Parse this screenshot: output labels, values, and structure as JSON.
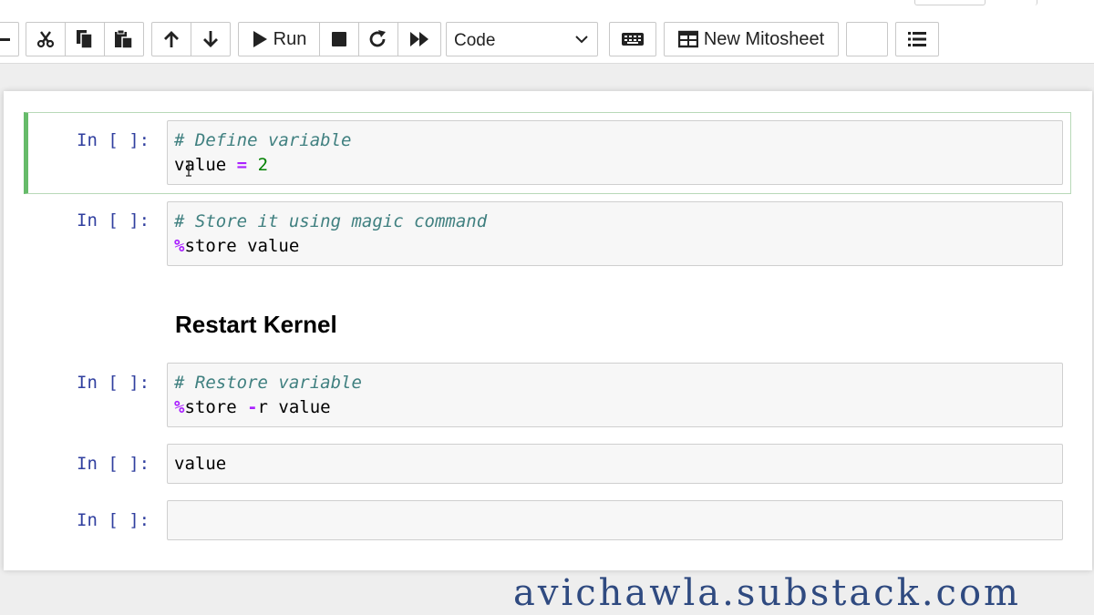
{
  "toolbar": {
    "run_label": "Run",
    "cell_type": "Code",
    "mitosheet_label": "New Mitosheet"
  },
  "cells": [
    {
      "prompt": "In [ ]:",
      "comment": "# Define variable",
      "code": [
        "value",
        "=",
        "2"
      ]
    },
    {
      "prompt": "In [ ]:",
      "comment": "# Store it using magic command",
      "code": [
        "%",
        "store value"
      ]
    },
    {
      "heading": "Restart Kernel"
    },
    {
      "prompt": "In [ ]:",
      "comment": "# Restore variable",
      "code": [
        "%",
        "store ",
        "-",
        "r value"
      ]
    },
    {
      "prompt": "In [ ]:",
      "code": [
        "value"
      ]
    },
    {
      "prompt": "In [ ]:",
      "code": []
    }
  ],
  "watermark": "avichawla.substack.com",
  "colors": {
    "prompt": "#303f9f",
    "comment": "#408080",
    "magic": "#aa22ff",
    "number": "#008000",
    "selected_border": "#66bb6a",
    "watermark": "#2f4a80"
  },
  "icons": [
    "plus-icon",
    "cut-icon",
    "copy-icon",
    "paste-icon",
    "arrow-up-icon",
    "arrow-down-icon",
    "run-icon",
    "stop-icon",
    "restart-icon",
    "fast-forward-icon",
    "chevron-down-icon",
    "keyboard-icon",
    "table-icon",
    "list-icon"
  ]
}
